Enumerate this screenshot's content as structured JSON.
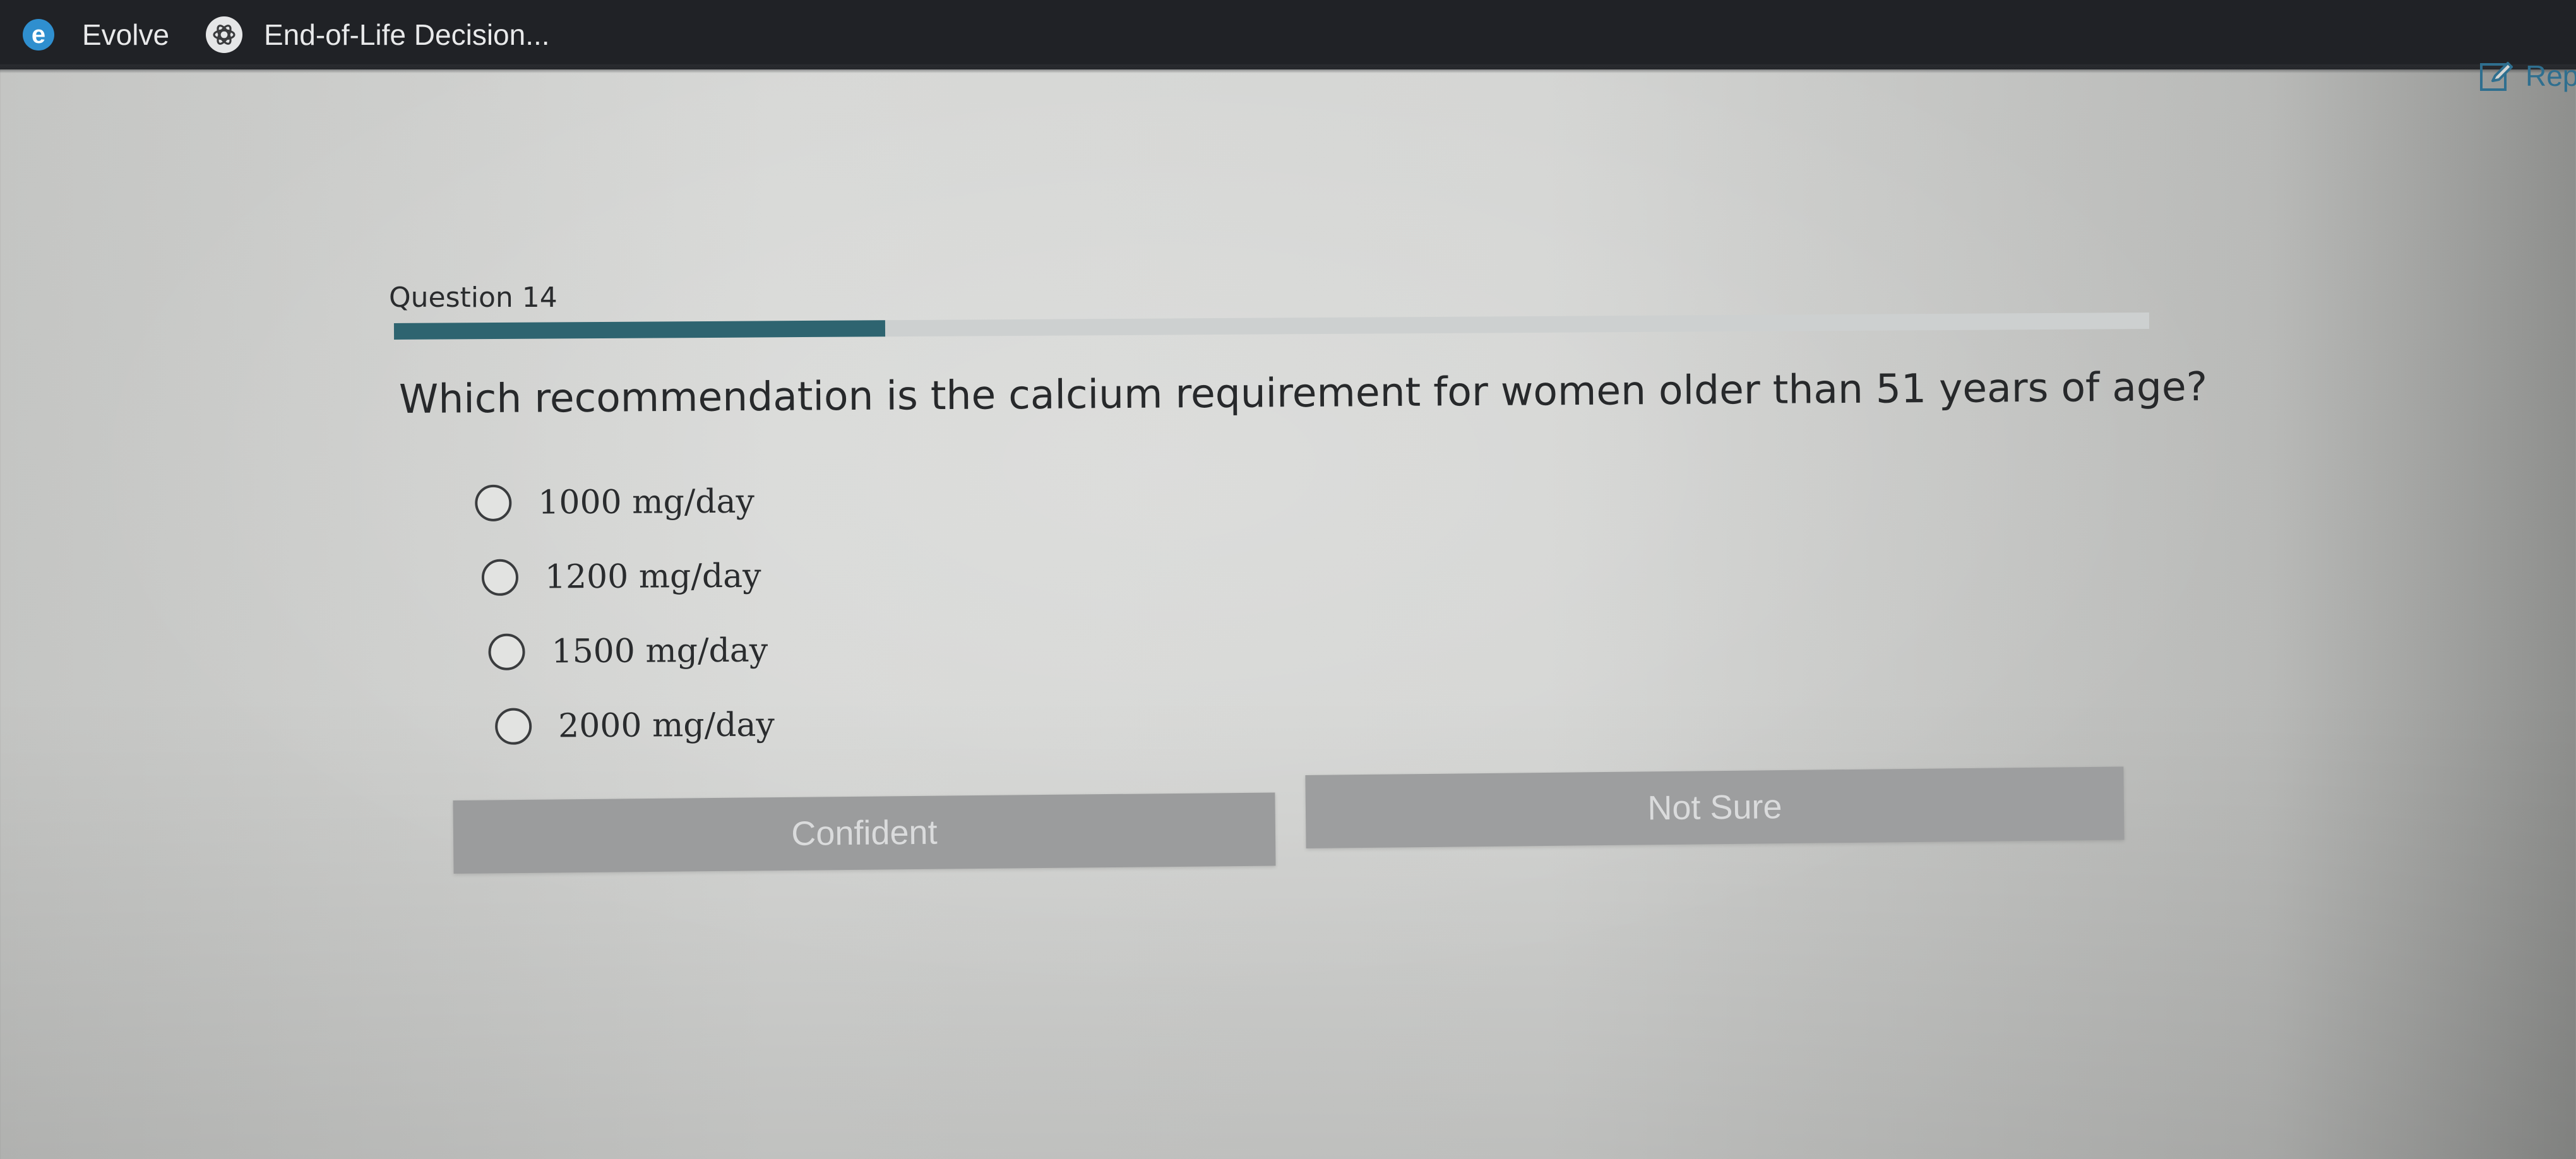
{
  "tabs": [
    {
      "label": "Evolve",
      "icon": "evolve-logo-icon"
    },
    {
      "label": "End-of-Life Decision...",
      "icon": "openai-logo-icon"
    }
  ],
  "toolbar": {
    "report_label": "Rep"
  },
  "question": {
    "number_label": "Question 14",
    "progress_fraction": 0.28,
    "text": "Which recommendation is the calcium requirement for women older than 51 years of age?",
    "options": [
      {
        "label": "1000 mg/day"
      },
      {
        "label": "1200 mg/day"
      },
      {
        "label": "1500 mg/day"
      },
      {
        "label": "2000 mg/day"
      }
    ]
  },
  "buttons": {
    "confident_label": "Confident",
    "not_sure_label": "Not Sure"
  },
  "colors": {
    "progress": "#2e6470",
    "tabbar": "#202226",
    "evolve_accent": "#2f8fcf",
    "report_link": "#2f6f8f",
    "button_bg": "#9b9c9d"
  }
}
